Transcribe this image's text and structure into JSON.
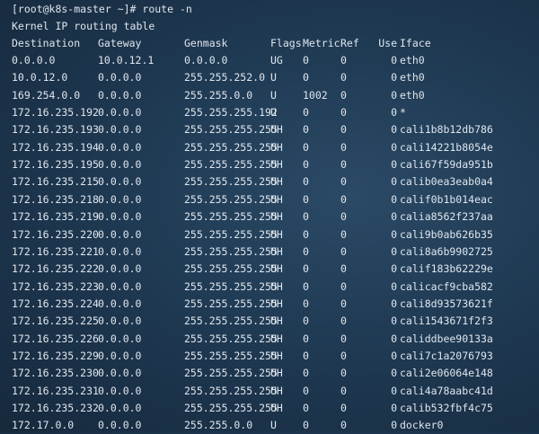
{
  "terminal": {
    "prompt": "[root@k8s-master ~]# route -n",
    "title": "Kernel IP routing table",
    "headers": {
      "destination": "Destination",
      "gateway": "Gateway",
      "genmask": "Genmask",
      "flags": "Flags",
      "metric": "Metric",
      "ref": "Ref",
      "use": "Use",
      "iface": "Iface"
    },
    "routes": [
      {
        "destination": "0.0.0.0",
        "gateway": "10.0.12.1",
        "genmask": "0.0.0.0",
        "flags": "UG",
        "metric": "0",
        "ref": "0",
        "use": "0",
        "iface": "eth0"
      },
      {
        "destination": "10.0.12.0",
        "gateway": "0.0.0.0",
        "genmask": "255.255.252.0",
        "flags": "U",
        "metric": "0",
        "ref": "0",
        "use": "0",
        "iface": "eth0"
      },
      {
        "destination": "169.254.0.0",
        "gateway": "0.0.0.0",
        "genmask": "255.255.0.0",
        "flags": "U",
        "metric": "1002",
        "ref": "0",
        "use": "0",
        "iface": "eth0"
      },
      {
        "destination": "172.16.235.192",
        "gateway": "0.0.0.0",
        "genmask": "255.255.255.192",
        "flags": "U",
        "metric": "0",
        "ref": "0",
        "use": "0",
        "iface": "*"
      },
      {
        "destination": "172.16.235.193",
        "gateway": "0.0.0.0",
        "genmask": "255.255.255.255",
        "flags": "UH",
        "metric": "0",
        "ref": "0",
        "use": "0",
        "iface": "cali1b8b12db786"
      },
      {
        "destination": "172.16.235.194",
        "gateway": "0.0.0.0",
        "genmask": "255.255.255.255",
        "flags": "UH",
        "metric": "0",
        "ref": "0",
        "use": "0",
        "iface": "cali14221b8054e"
      },
      {
        "destination": "172.16.235.195",
        "gateway": "0.0.0.0",
        "genmask": "255.255.255.255",
        "flags": "UH",
        "metric": "0",
        "ref": "0",
        "use": "0",
        "iface": "cali67f59da951b"
      },
      {
        "destination": "172.16.235.215",
        "gateway": "0.0.0.0",
        "genmask": "255.255.255.255",
        "flags": "UH",
        "metric": "0",
        "ref": "0",
        "use": "0",
        "iface": "calib0ea3eab0a4"
      },
      {
        "destination": "172.16.235.218",
        "gateway": "0.0.0.0",
        "genmask": "255.255.255.255",
        "flags": "UH",
        "metric": "0",
        "ref": "0",
        "use": "0",
        "iface": "calif0b1b014eac"
      },
      {
        "destination": "172.16.235.219",
        "gateway": "0.0.0.0",
        "genmask": "255.255.255.255",
        "flags": "UH",
        "metric": "0",
        "ref": "0",
        "use": "0",
        "iface": "calia8562f237aa"
      },
      {
        "destination": "172.16.235.220",
        "gateway": "0.0.0.0",
        "genmask": "255.255.255.255",
        "flags": "UH",
        "metric": "0",
        "ref": "0",
        "use": "0",
        "iface": "cali9b0ab626b35"
      },
      {
        "destination": "172.16.235.221",
        "gateway": "0.0.0.0",
        "genmask": "255.255.255.255",
        "flags": "UH",
        "metric": "0",
        "ref": "0",
        "use": "0",
        "iface": "cali8a6b9902725"
      },
      {
        "destination": "172.16.235.222",
        "gateway": "0.0.0.0",
        "genmask": "255.255.255.255",
        "flags": "UH",
        "metric": "0",
        "ref": "0",
        "use": "0",
        "iface": "calif183b62229e"
      },
      {
        "destination": "172.16.235.223",
        "gateway": "0.0.0.0",
        "genmask": "255.255.255.255",
        "flags": "UH",
        "metric": "0",
        "ref": "0",
        "use": "0",
        "iface": "calicacf9cba582"
      },
      {
        "destination": "172.16.235.224",
        "gateway": "0.0.0.0",
        "genmask": "255.255.255.255",
        "flags": "UH",
        "metric": "0",
        "ref": "0",
        "use": "0",
        "iface": "cali8d93573621f"
      },
      {
        "destination": "172.16.235.225",
        "gateway": "0.0.0.0",
        "genmask": "255.255.255.255",
        "flags": "UH",
        "metric": "0",
        "ref": "0",
        "use": "0",
        "iface": "cali1543671f2f3"
      },
      {
        "destination": "172.16.235.226",
        "gateway": "0.0.0.0",
        "genmask": "255.255.255.255",
        "flags": "UH",
        "metric": "0",
        "ref": "0",
        "use": "0",
        "iface": "caliddbee90133a"
      },
      {
        "destination": "172.16.235.229",
        "gateway": "0.0.0.0",
        "genmask": "255.255.255.255",
        "flags": "UH",
        "metric": "0",
        "ref": "0",
        "use": "0",
        "iface": "cali7c1a2076793"
      },
      {
        "destination": "172.16.235.230",
        "gateway": "0.0.0.0",
        "genmask": "255.255.255.255",
        "flags": "UH",
        "metric": "0",
        "ref": "0",
        "use": "0",
        "iface": "cali2e06064e148"
      },
      {
        "destination": "172.16.235.231",
        "gateway": "0.0.0.0",
        "genmask": "255.255.255.255",
        "flags": "UH",
        "metric": "0",
        "ref": "0",
        "use": "0",
        "iface": "cali4a78aabc41d"
      },
      {
        "destination": "172.16.235.232",
        "gateway": "0.0.0.0",
        "genmask": "255.255.255.255",
        "flags": "UH",
        "metric": "0",
        "ref": "0",
        "use": "0",
        "iface": "calib532fbf4c75"
      },
      {
        "destination": "172.17.0.0",
        "gateway": "0.0.0.0",
        "genmask": "255.255.0.0",
        "flags": "U",
        "metric": "0",
        "ref": "0",
        "use": "0",
        "iface": "docker0"
      }
    ]
  },
  "colors": {
    "background": "#1f3a53",
    "text": "#dfe6ee"
  }
}
